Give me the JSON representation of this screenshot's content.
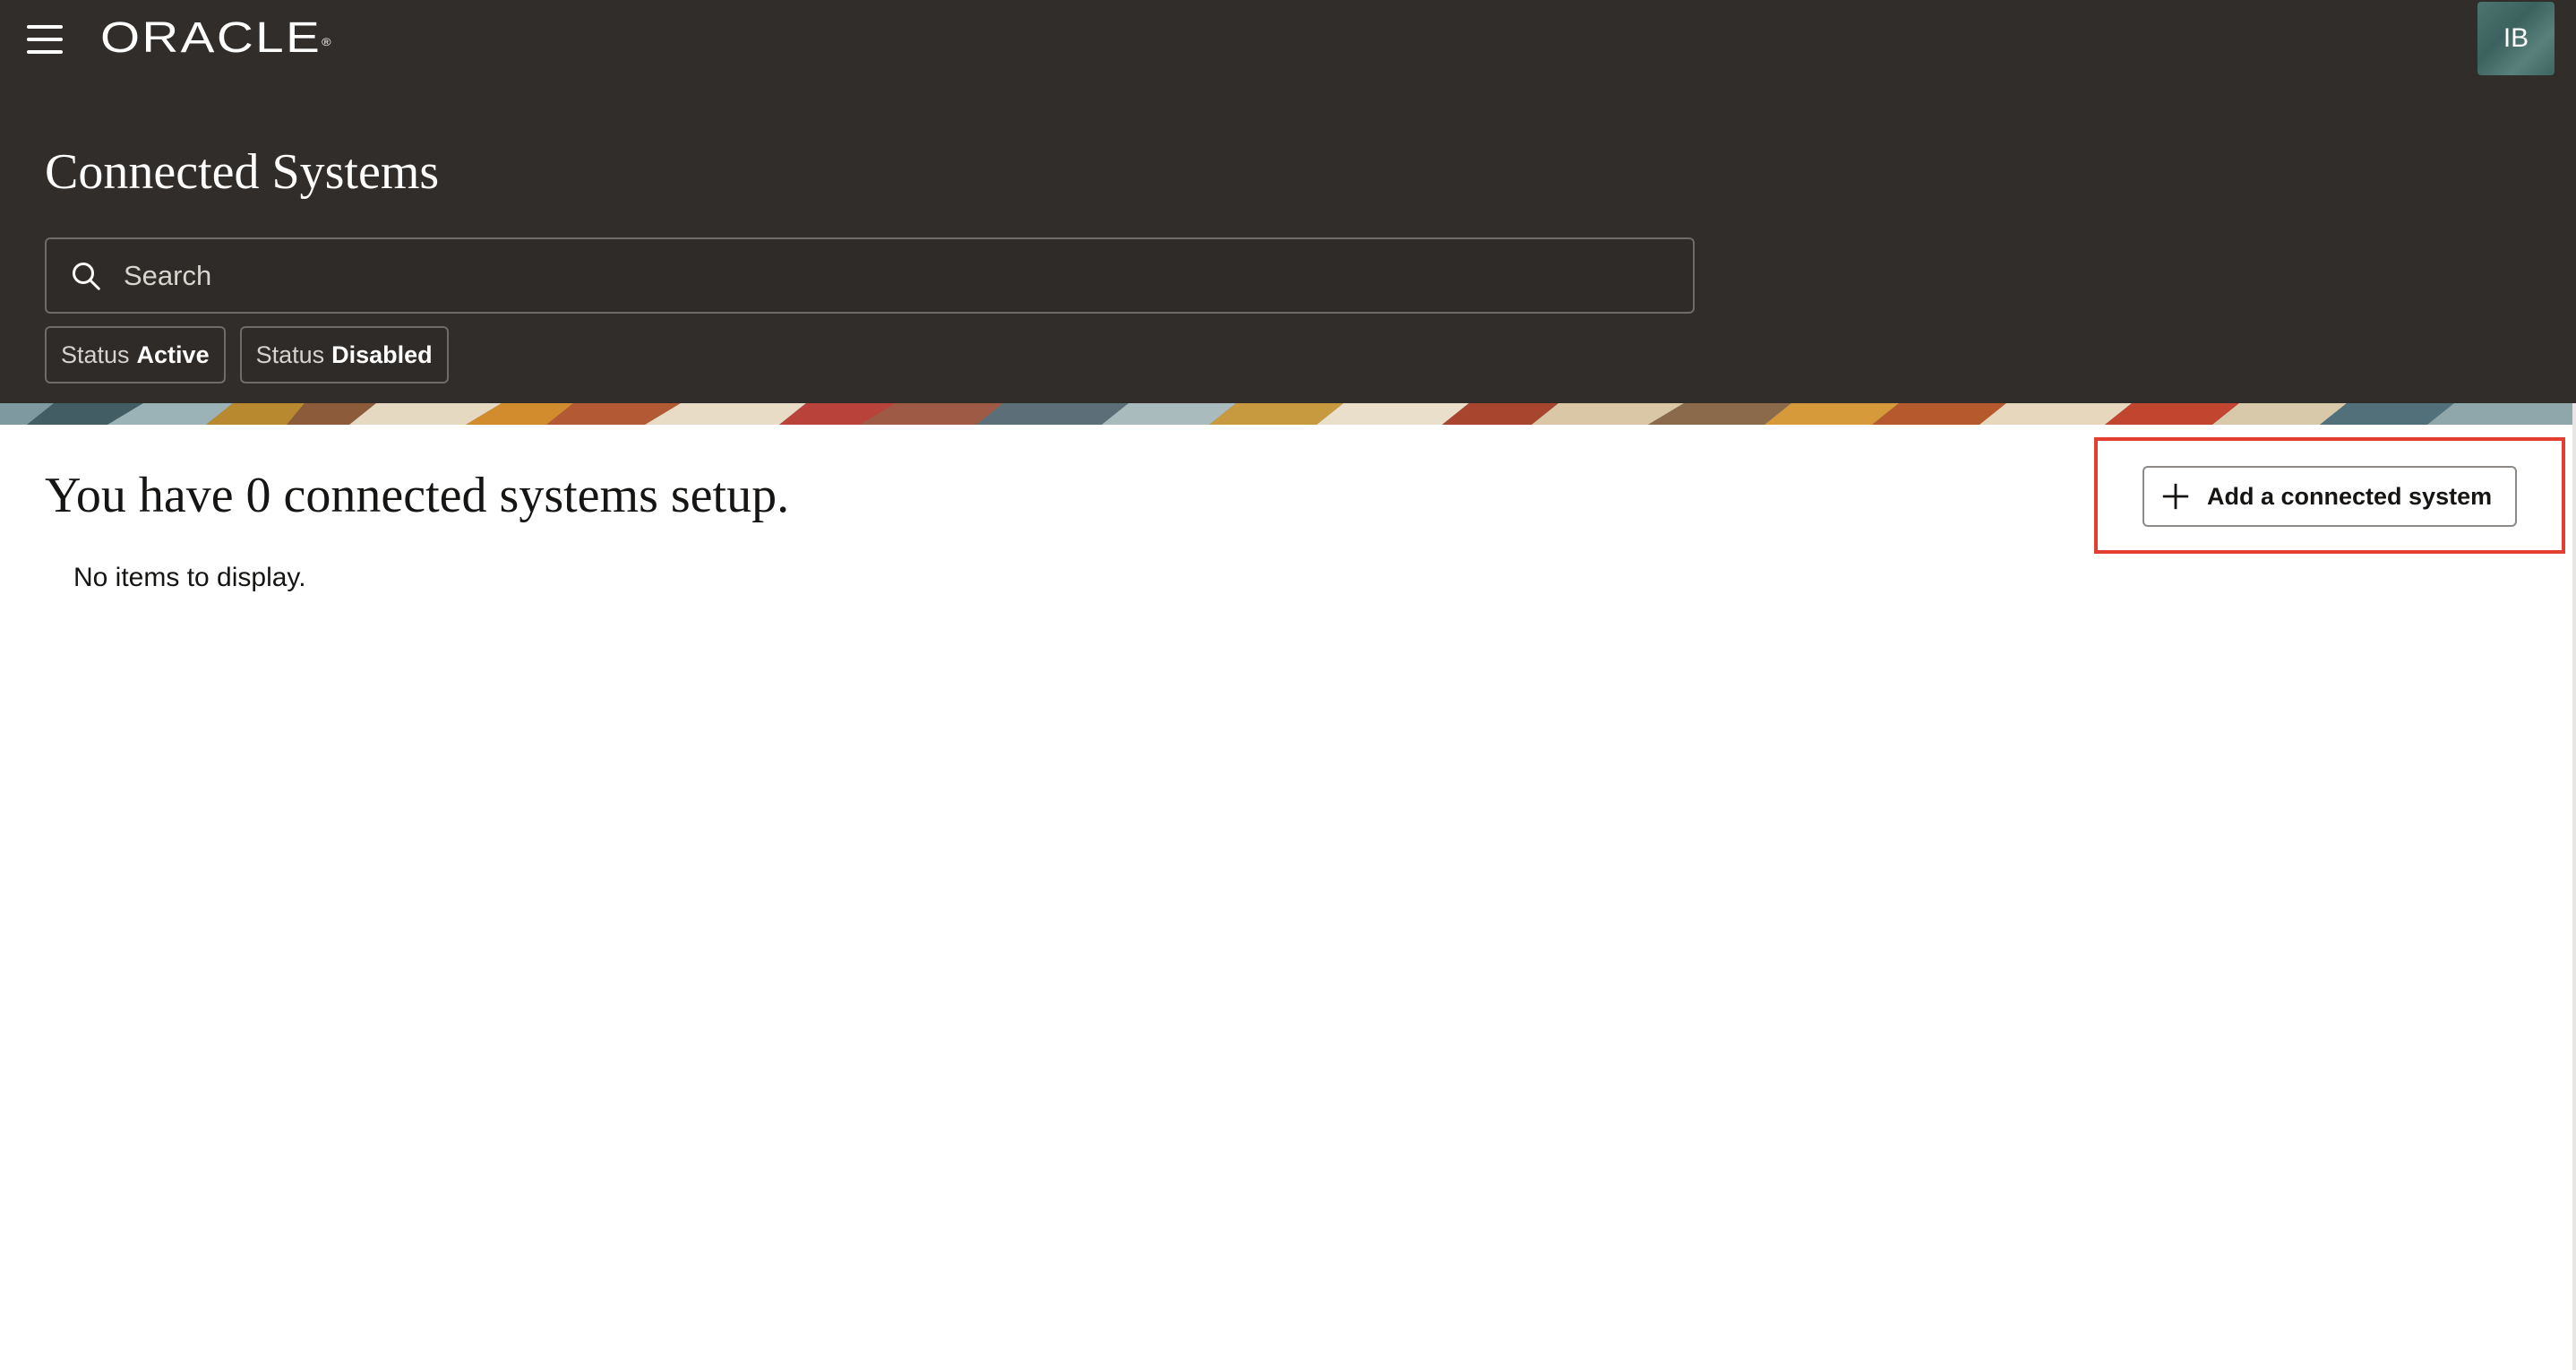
{
  "header": {
    "brand": "ORACLE",
    "brand_mark": "®",
    "avatar_initials": "IB",
    "menu_icon": "hamburger-menu-icon"
  },
  "page": {
    "title": "Connected Systems"
  },
  "search": {
    "placeholder": "Search",
    "value": "",
    "icon": "search-icon"
  },
  "filters": [
    {
      "label": "Status",
      "value": "Active"
    },
    {
      "label": "Status",
      "value": "Disabled"
    }
  ],
  "main": {
    "heading": "You have 0 connected systems setup.",
    "empty_message": "No items to display.",
    "add_button_label": "Add a connected system",
    "add_button_icon": "plus-icon"
  },
  "colors": {
    "header_bg": "#312d2a",
    "highlight": "#e23f30",
    "avatar_bg": "#4e7470"
  }
}
